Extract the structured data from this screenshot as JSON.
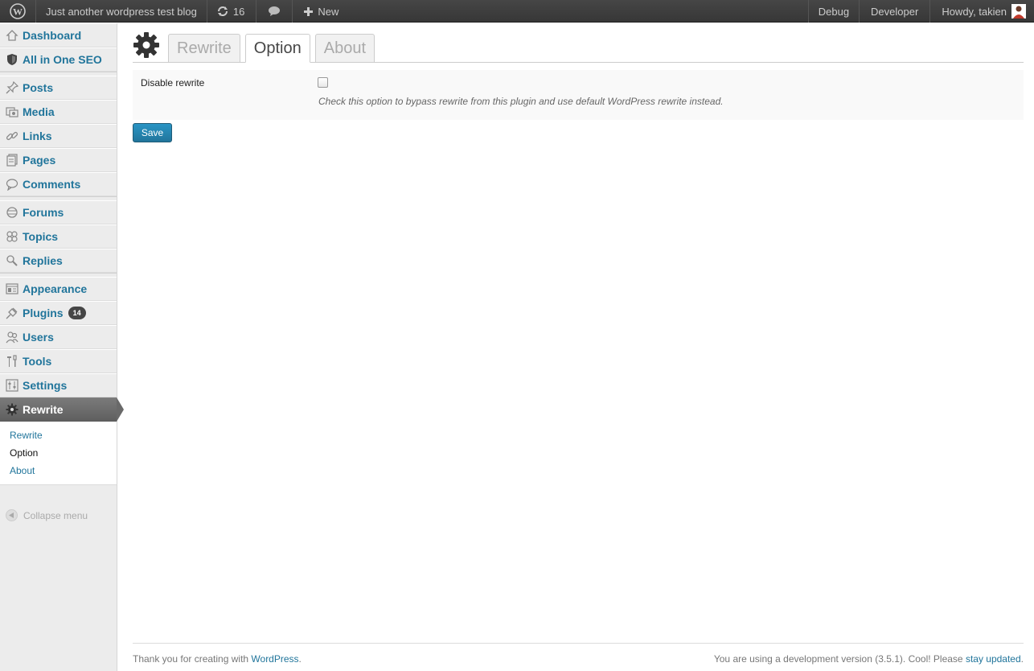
{
  "adminbar": {
    "site_name": "Just another wordpress test blog",
    "updates_count": "16",
    "new_label": "New",
    "debug_label": "Debug",
    "developer_label": "Developer",
    "howdy_label": "Howdy, takien"
  },
  "sidebar": {
    "items": [
      {
        "label": "Dashboard",
        "icon": "dashboard-icon"
      },
      {
        "label": "All in One SEO",
        "icon": "seo-shield-icon"
      },
      {
        "label": "Posts",
        "icon": "pin-icon"
      },
      {
        "label": "Media",
        "icon": "media-icon"
      },
      {
        "label": "Links",
        "icon": "link-icon"
      },
      {
        "label": "Pages",
        "icon": "pages-icon"
      },
      {
        "label": "Comments",
        "icon": "comment-icon"
      },
      {
        "label": "Forums",
        "icon": "forum-icon"
      },
      {
        "label": "Topics",
        "icon": "topics-icon"
      },
      {
        "label": "Replies",
        "icon": "replies-icon"
      },
      {
        "label": "Appearance",
        "icon": "appearance-icon"
      },
      {
        "label": "Plugins",
        "icon": "plugin-icon",
        "badge": "14"
      },
      {
        "label": "Users",
        "icon": "users-icon"
      },
      {
        "label": "Tools",
        "icon": "tools-icon"
      },
      {
        "label": "Settings",
        "icon": "settings-icon"
      },
      {
        "label": "Rewrite",
        "icon": "gear-icon"
      }
    ],
    "submenu": [
      "Rewrite",
      "Option",
      "About"
    ],
    "collapse_label": "Collapse menu"
  },
  "main": {
    "tabs": [
      "Rewrite",
      "Option",
      "About"
    ],
    "active_tab": "Option",
    "field_label": "Disable rewrite",
    "checkbox_checked": false,
    "field_description": "Check this option to bypass rewrite from this plugin and use default WordPress rewrite instead.",
    "save_label": "Save"
  },
  "footer": {
    "left_text": "Thank you for creating with ",
    "left_link": "WordPress",
    "left_end": ".",
    "right_text": "You are using a development version (3.5.1). Cool! Please ",
    "right_link": "stay updated",
    "right_end": "."
  },
  "colors": {
    "link": "#21759b",
    "adminbar": "#464646",
    "current_menu": "#6d6d6d"
  }
}
